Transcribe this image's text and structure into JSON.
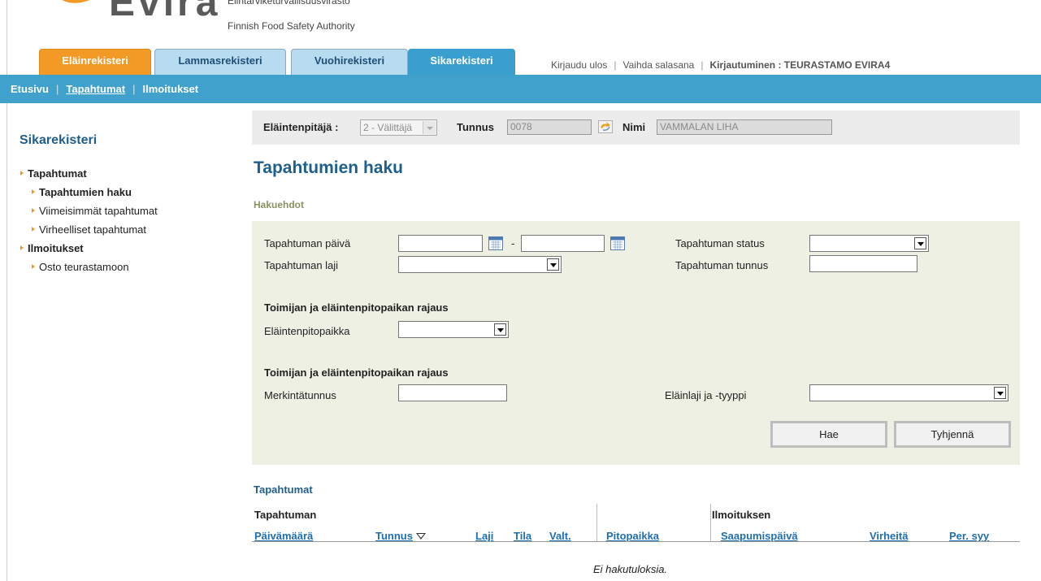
{
  "header": {
    "logo_text": "Evira",
    "agency_fi": "Elintarviketurvallisuusvirasto",
    "agency_en": "Finnish Food Safety Authority"
  },
  "tabs": [
    {
      "label": "Eläinrekisteri",
      "color": "#f39a26"
    },
    {
      "label": "Lammasrekisteri",
      "color": "#b8dcef"
    },
    {
      "label": "Vuohirekisteri",
      "color": "#b8dcef"
    },
    {
      "label": "Sikarekisteri",
      "color": "#3a9fcf",
      "active": true
    }
  ],
  "top_links": {
    "logout": "Kirjaudu ulos",
    "change_password": "Vaihda salasana",
    "login_info": "Kirjautuminen : TEURASTAMO EVIRA4"
  },
  "navbar": {
    "items": [
      "Etusivu",
      "Tapahtumat",
      "Ilmoitukset"
    ],
    "active": "Tapahtumat"
  },
  "sidebar": {
    "title": "Sikarekisteri",
    "items": [
      {
        "label": "Tapahtumat",
        "level": 1
      },
      {
        "label": "Tapahtumien haku",
        "level": 2,
        "current": true
      },
      {
        "label": "Viimeisimmät tapahtumat",
        "level": 2
      },
      {
        "label": "Virheelliset tapahtumat",
        "level": 2
      },
      {
        "label": "Ilmoitukset",
        "level": 1
      },
      {
        "label": "Osto teurastamoon",
        "level": 2
      }
    ]
  },
  "keeper_bar": {
    "keeper_label": "Eläintenpitäjä :",
    "keeper_value": "2 - Välittäjä",
    "id_label": "Tunnus",
    "id_value": "0078",
    "name_label": "Nimi",
    "name_value": "VAMMALAN LIHA"
  },
  "main": {
    "title": "Tapahtumien haku",
    "criteria_title": "Hakuehdot"
  },
  "search": {
    "date_label": "Tapahtuman päivä",
    "date_from": "",
    "date_separator": "-",
    "date_to": "",
    "type_label": "Tapahtuman laji",
    "type_value": "",
    "status_label": "Tapahtuman status",
    "status_value": "",
    "event_id_label": "Tapahtuman tunnus",
    "event_id_value": "",
    "section1_title": "Toimijan ja eläintenpitopaikan rajaus",
    "holding_label": "Eläintenpitopaikka",
    "holding_value": "",
    "section2_title": "Toimijan ja eläintenpitopaikan rajaus",
    "mark_label": "Merkintätunnus",
    "mark_value": "",
    "species_label": "Eläinlaji ja -tyyppi",
    "species_value": "",
    "search_button": "Hae",
    "clear_button": "Tyhjennä"
  },
  "results": {
    "title": "Tapahtumat",
    "group_event": "Tapahtuman",
    "group_report": "Ilmoituksen",
    "columns": [
      "Päivämäärä",
      "Tunnus",
      "Laji",
      "Tila",
      "Valt.",
      "Pitopaikka",
      "Saapumispäivä",
      "Virheitä",
      "Per. syy"
    ],
    "sorted_by": "Tunnus",
    "empty_message": "Ei hakutuloksia."
  },
  "colors": {
    "accent_blue": "#3fa1cc",
    "title_blue": "#1f5f8b",
    "link_blue": "#1f6fb0",
    "panel_bg": "#eef0e3",
    "orange": "#f39a26"
  }
}
